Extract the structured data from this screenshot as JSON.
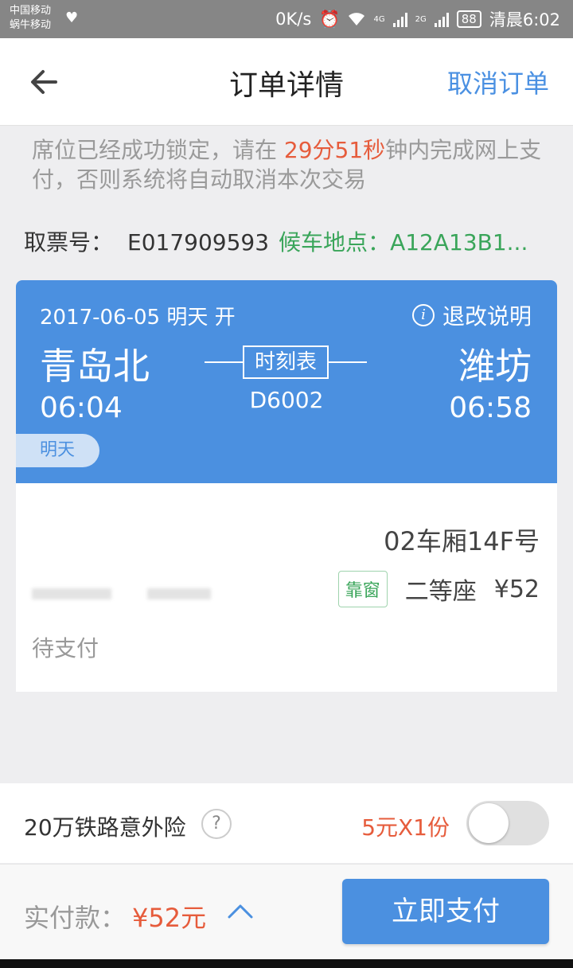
{
  "status_bar": {
    "carrier_1": "中国移动",
    "carrier_2": "蜗牛移动",
    "net_speed": "0K/s",
    "signal_1": "4G",
    "signal_2": "2G",
    "battery": "88",
    "time": "清晨6:02"
  },
  "header": {
    "back_icon": "arrow-left-icon",
    "title": "订单详情",
    "cancel_label": "取消订单"
  },
  "notice": {
    "prefix": "席位已经成功锁定，请在 ",
    "countdown": "29分51秒",
    "suffix": "钟内完成网上支付，否则系统将自动取消本次交易"
  },
  "ticket_info": {
    "ticket_label": "取票号：",
    "ticket_number": "E017909593",
    "gate_label": "候车地点：",
    "gate_value": "A12A13B1..."
  },
  "trip": {
    "date": "2017-06-05  明天  开",
    "policy_label": "退改说明",
    "from_station": "青岛北",
    "to_station": "潍坊",
    "depart_time": "06:04",
    "arrive_time": "06:58",
    "timetable_label": "时刻表",
    "train_number": "D6002",
    "day_tag": "明天"
  },
  "passenger": {
    "coach_seat": "02车厢14F号",
    "window_tag": "靠窗",
    "seat_class": "二等座",
    "price": "¥52",
    "status": "待支付"
  },
  "insurance": {
    "label": "20万铁路意外险",
    "help_icon": "question-icon",
    "price": "5元X1份",
    "enabled": false
  },
  "payment": {
    "label": "实付款：",
    "amount": "¥52元",
    "expand_icon": "chevron-up-icon",
    "pay_button": "立即支付"
  },
  "colors": {
    "accent": "#4b90e0",
    "price": "#e65c3c",
    "green": "#3aa55a"
  }
}
